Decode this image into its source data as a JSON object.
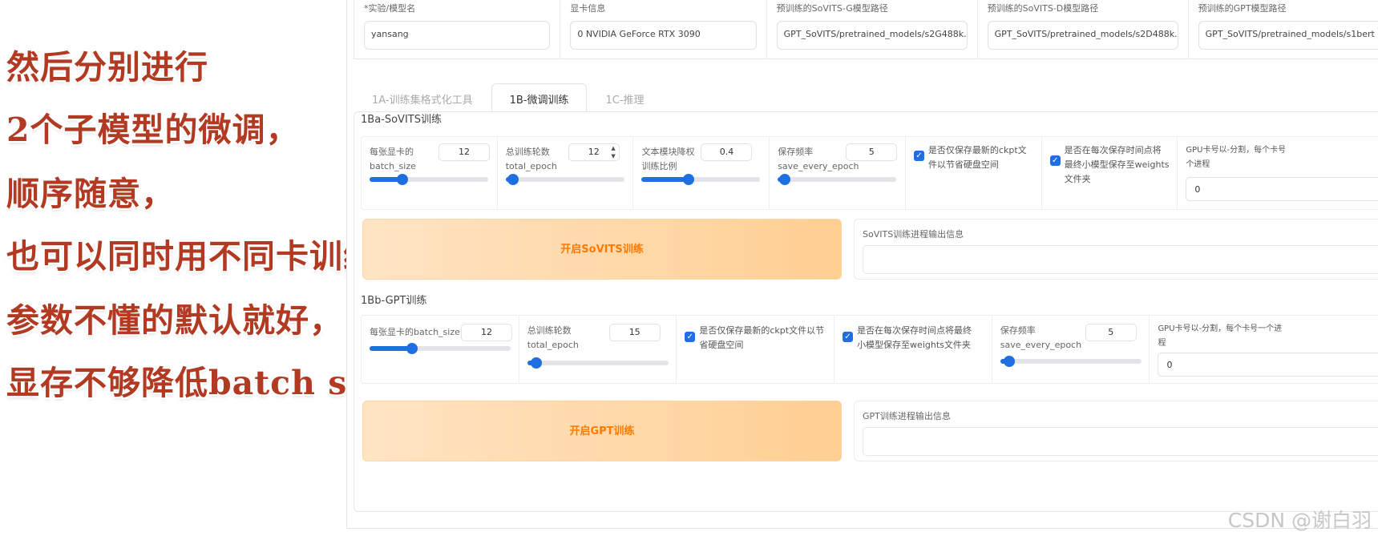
{
  "caption": {
    "lines": [
      "然后分别进行",
      "2个子模型的微调，",
      "顺序随意，",
      "也可以同时用不同卡训练。",
      "参数不懂的默认就好，",
      "显存不够降低batch size。"
    ]
  },
  "top_fields": [
    {
      "label": "*实验/模型名",
      "value": "yansang"
    },
    {
      "label": "显卡信息",
      "value": "0  NVIDIA GeForce RTX 3090"
    },
    {
      "label": "预训练的SoVITS-G模型路径",
      "value": "GPT_SoVITS/pretrained_models/s2G488k."
    },
    {
      "label": "预训练的SoVITS-D模型路径",
      "value": "GPT_SoVITS/pretrained_models/s2D488k."
    },
    {
      "label": "预训练的GPT模型路径",
      "value": "GPT_SoVITS/pretrained_models/s1bert"
    }
  ],
  "tabs": [
    {
      "label": "1A-训练集格式化工具",
      "active": false
    },
    {
      "label": "1B-微调训练",
      "active": true
    },
    {
      "label": "1C-推理",
      "active": false
    }
  ],
  "sovits": {
    "title": "1Ba-SoVITS训练",
    "batch_label_1": "每张显卡的",
    "batch_label_2": "batch_size",
    "batch_value": "12",
    "batch_fraction": 0.28,
    "epoch_label_1": "总训练轮数",
    "epoch_label_2": "total_epoch",
    "epoch_value": "12",
    "epoch_fraction": 0.06,
    "text_label_1": "文本模块降权",
    "text_label_2": "训练比例",
    "text_value": "0.4",
    "text_fraction": 0.4,
    "save_label_1": "保存频率",
    "save_label_2": "save_every_epoch",
    "save_value": "5",
    "save_fraction": 0.06,
    "ckpt_label_1": "是否仅保存最新的ckpt文",
    "ckpt_label_2": "件以节省硬盘空间",
    "weights_label_1": "是否在每次保存时间点将",
    "weights_label_2": "最终小模型保存至weights",
    "weights_label_3": "文件夹",
    "gpu_label_1": "GPU卡号以-分割，每个卡号",
    "gpu_label_2": "个进程",
    "gpu_value": "0",
    "start_button": "开启SoVITS训练",
    "output_label": "SoVITS训练进程输出信息"
  },
  "gpt": {
    "title": "1Bb-GPT训练",
    "batch_label": "每张显卡的batch_size",
    "batch_value": "12",
    "batch_fraction": 0.3,
    "epoch_label_1": "总训练轮数",
    "epoch_label_2": "total_epoch",
    "epoch_value": "15",
    "epoch_fraction": 0.06,
    "ckpt_label_1": "是否仅保存最新的ckpt文件以节",
    "ckpt_label_2": "省硬盘空间",
    "weights_label_1": "是否在每次保存时间点将最终",
    "weights_label_2": "小模型保存至weights文件夹",
    "save_label_1": "保存频率",
    "save_label_2": "save_every_epoch",
    "save_value": "5",
    "save_fraction": 0.06,
    "gpu_label_1": "GPU卡号以-分割，每个卡号一个进",
    "gpu_label_2": "程",
    "gpu_value": "0",
    "start_button": "开启GPT训练",
    "output_label": "GPT训练进程输出信息"
  },
  "watermark": "CSDN @谢白羽",
  "colors": {
    "accent": "#1f6fe0",
    "button_text": "#ff7a00",
    "caption": "#b23a22"
  }
}
